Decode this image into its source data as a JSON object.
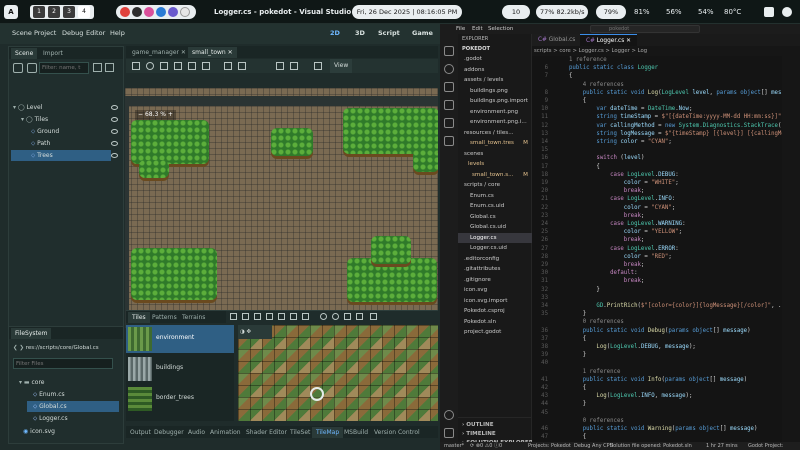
{
  "topbar": {
    "launcher": "A",
    "workspaces": [
      "1",
      "2",
      "3",
      "4"
    ],
    "window_title": "Logger.cs - pokedot - Visual Studio Code",
    "datetime": "Fri, 26 Dec 2025 | 08:16:05 PM",
    "tray": {
      "notif_count": "10",
      "network": "77% 82.2kb/s",
      "battery_pct": "79%",
      "cpu": "81%",
      "mem": "56%",
      "vol": "54%",
      "temp": "80°C"
    }
  },
  "godot": {
    "menu": [
      "Scene",
      "Project",
      "Debug",
      "Editor",
      "Help"
    ],
    "modes": {
      "two_d": "2D",
      "three_d": "3D",
      "script": "Script",
      "game": "Game"
    },
    "scene_tabs": {
      "scene": "Scene",
      "import": "Import"
    },
    "filter_placeholder": "Filter: name, t",
    "scene_tree": [
      {
        "label": "Level"
      },
      {
        "label": "Tiles"
      },
      {
        "label": "Ground"
      },
      {
        "label": "Path"
      },
      {
        "label": "Trees"
      }
    ],
    "editor_tabs": {
      "game_manager": "game_manager",
      "small_town": "small_town"
    },
    "view_btn": "View",
    "zoom": "68.3 %",
    "filesystem": {
      "title": "FileSystem",
      "path": "res://scripts/core/Global.cs",
      "filter_placeholder": "Filter Files",
      "items": [
        {
          "label": "core"
        },
        {
          "label": "Enum.cs"
        },
        {
          "label": "Global.cs"
        },
        {
          "label": "Logger.cs"
        },
        {
          "label": "icon.svg"
        }
      ]
    },
    "tileset_tabs": {
      "tiles": "Tiles",
      "patterns": "Patterns",
      "terrains": "Terrains"
    },
    "sources": [
      {
        "label": "environment"
      },
      {
        "label": "buildings"
      },
      {
        "label": "border_trees"
      }
    ],
    "bottom_tabs": [
      "Output",
      "Debugger",
      "Audio",
      "Animation",
      "Shader Editor",
      "TileSet",
      "TileMap",
      "MSBuild",
      "Version Control"
    ]
  },
  "vscode": {
    "explorer_title": "EXPLORER",
    "project": "POKEDOT",
    "search_placeholder": "pokedot",
    "menu": [
      "File",
      "Edit",
      "Selection"
    ],
    "tabs": {
      "global": "Global.cs",
      "logger": "Logger.cs"
    },
    "breadcrumb": "scripts > core > Logger.cs > Logger > Log",
    "files": [
      {
        "label": ".godot",
        "color": "#cccccc"
      },
      {
        "label": "addons",
        "color": "#cccccc"
      },
      {
        "label": "assets / levels",
        "color": "#cccccc"
      },
      {
        "label": "buildings.png",
        "color": "#cccccc"
      },
      {
        "label": "buildings.png.import",
        "color": "#cccccc"
      },
      {
        "label": "environment.png",
        "color": "#cccccc"
      },
      {
        "label": "environment.png.i...",
        "color": "#cccccc"
      },
      {
        "label": "resources / tiles...",
        "color": "#cccccc"
      },
      {
        "label": "small_town.tres",
        "color": "#e2c08d",
        "badge": "M"
      },
      {
        "label": "scenes",
        "color": "#cccccc"
      },
      {
        "label": "levels",
        "color": "#e2c08d"
      },
      {
        "label": "small_town.s...",
        "color": "#e2c08d",
        "badge": "M"
      },
      {
        "label": "scripts / core",
        "color": "#cccccc"
      },
      {
        "label": "Enum.cs",
        "color": "#cccccc"
      },
      {
        "label": "Enum.cs.uid",
        "color": "#cccccc"
      },
      {
        "label": "Global.cs",
        "color": "#cccccc"
      },
      {
        "label": "Global.cs.uid",
        "color": "#cccccc"
      },
      {
        "label": "Logger.cs",
        "color": "#ffffff"
      },
      {
        "label": "Logger.cs.uid",
        "color": "#cccccc"
      },
      {
        "label": ".editorconfig",
        "color": "#cccccc"
      },
      {
        "label": ".gitattributes",
        "color": "#cccccc"
      },
      {
        "label": ".gitignore",
        "color": "#cccccc"
      },
      {
        "label": "icon.svg",
        "color": "#cccccc"
      },
      {
        "label": "icon.svg.import",
        "color": "#cccccc"
      },
      {
        "label": "Pokedot.csproj",
        "color": "#cccccc"
      },
      {
        "label": "Pokedot.sln",
        "color": "#cccccc"
      },
      {
        "label": "project.godot",
        "color": "#cccccc"
      }
    ],
    "outline": [
      "OUTLINE",
      "TIMELINE",
      "SOLUTION EXPLORER"
    ],
    "code": [
      {
        "ln": "",
        "html": "<span class='ref'>1 reference</span>"
      },
      {
        "ln": "6",
        "html": "<span class='k'>public static class</span> <span class='t'>Logger</span>"
      },
      {
        "ln": "7",
        "html": "<span class='p'>{</span>"
      },
      {
        "ln": "",
        "html": "    <span class='ref'>4 references</span>"
      },
      {
        "ln": "8",
        "html": "    <span class='k'>public static void</span> <span class='f'>Log</span><span class='p'>(</span><span class='t'>LogLevel</span> <span class='v'>level</span><span class='p'>, </span><span class='k'>params object</span><span class='p'>[] </span><span class='v'>message</span><span class='p'>)</span>"
      },
      {
        "ln": "9",
        "html": "    <span class='p'>{</span>"
      },
      {
        "ln": "10",
        "html": "        <span class='k'>var</span> <span class='v'>dateTime</span> <span class='p'>= </span><span class='t'>DateTime</span><span class='p'>.</span><span class='v'>Now</span><span class='p'>;</span>"
      },
      {
        "ln": "11",
        "html": "        <span class='k'>string</span> <span class='v'>timeStamp</span> <span class='p'>= </span><span class='s'>$\"[{dateTime:yyyy-MM-dd HH:mm:ss}]\"</span><span class='p'>;</span>"
      },
      {
        "ln": "12",
        "html": "        <span class='k'>var</span> <span class='v'>callingMethod</span> <span class='p'>= </span><span class='k'>new</span> <span class='t'>System.Diagnostics.StackTrace</span><span class='p'>().</span><span class='f'>GetFra</span>"
      },
      {
        "ln": "13",
        "html": "        <span class='k'>string</span> <span class='v'>logMessage</span> <span class='p'>= </span><span class='s'>$\"{timeStamp} [{level}] [{callingMethod.D</span>"
      },
      {
        "ln": "14",
        "html": "        <span class='k'>string</span> <span class='v'>color</span> <span class='p'>= </span><span class='s'>\"CYAN\"</span><span class='p'>;</span>"
      },
      {
        "ln": "15",
        "html": ""
      },
      {
        "ln": "16",
        "html": "        <span class='c'>switch</span> <span class='p'>(</span><span class='v'>level</span><span class='p'>)</span>"
      },
      {
        "ln": "17",
        "html": "        <span class='p'>{</span>"
      },
      {
        "ln": "18",
        "html": "            <span class='c'>case</span> <span class='t'>LogLevel</span><span class='p'>.</span><span class='v'>DEBUG</span><span class='p'>:</span>"
      },
      {
        "ln": "19",
        "html": "                <span class='v'>color</span> <span class='p'>= </span><span class='s'>\"WHITE\"</span><span class='p'>;</span>"
      },
      {
        "ln": "20",
        "html": "                <span class='c'>break</span><span class='p'>;</span>"
      },
      {
        "ln": "21",
        "html": "            <span class='c'>case</span> <span class='t'>LogLevel</span><span class='p'>.</span><span class='v'>INFO</span><span class='p'>:</span>"
      },
      {
        "ln": "22",
        "html": "                <span class='v'>color</span> <span class='p'>= </span><span class='s'>\"CYAN\"</span><span class='p'>;</span>"
      },
      {
        "ln": "23",
        "html": "                <span class='c'>break</span><span class='p'>;</span>"
      },
      {
        "ln": "24",
        "html": "            <span class='c'>case</span> <span class='t'>LogLevel</span><span class='p'>.</span><span class='v'>WARNING</span><span class='p'>:</span>"
      },
      {
        "ln": "25",
        "html": "                <span class='v'>color</span> <span class='p'>= </span><span class='s'>\"YELLOW\"</span><span class='p'>;</span>"
      },
      {
        "ln": "26",
        "html": "                <span class='c'>break</span><span class='p'>;</span>"
      },
      {
        "ln": "27",
        "html": "            <span class='c'>case</span> <span class='t'>LogLevel</span><span class='p'>.</span><span class='v'>ERROR</span><span class='p'>:</span>"
      },
      {
        "ln": "28",
        "html": "                <span class='v'>color</span> <span class='p'>= </span><span class='s'>\"RED\"</span><span class='p'>;</span>"
      },
      {
        "ln": "29",
        "html": "                <span class='c'>break</span><span class='p'>;</span>"
      },
      {
        "ln": "30",
        "html": "            <span class='c'>default</span><span class='p'>:</span>"
      },
      {
        "ln": "31",
        "html": "                <span class='c'>break</span><span class='p'>;</span>"
      },
      {
        "ln": "32",
        "html": "        <span class='p'>}</span>"
      },
      {
        "ln": "33",
        "html": ""
      },
      {
        "ln": "34",
        "html": "        <span class='t'>GD</span><span class='p'>.</span><span class='f'>PrintRich</span><span class='p'>(</span><span class='s'>$\"[color={color}]{logMessage}[/color]\"</span><span class='p'>, .. mess</span>"
      },
      {
        "ln": "35",
        "html": "    <span class='p'>}</span>"
      },
      {
        "ln": "",
        "html": "    <span class='ref'>0 references</span>"
      },
      {
        "ln": "36",
        "html": "    <span class='k'>public static void</span> <span class='f'>Debug</span><span class='p'>(</span><span class='k'>params object</span><span class='p'>[] </span><span class='v'>message</span><span class='p'>)</span>"
      },
      {
        "ln": "37",
        "html": "    <span class='p'>{</span>"
      },
      {
        "ln": "38",
        "html": "        <span class='f'>Log</span><span class='p'>(</span><span class='t'>LogLevel</span><span class='p'>.</span><span class='v'>DEBUG</span><span class='p'>, </span><span class='v'>message</span><span class='p'>);</span>"
      },
      {
        "ln": "39",
        "html": "    <span class='p'>}</span>"
      },
      {
        "ln": "40",
        "html": ""
      },
      {
        "ln": "",
        "html": "    <span class='ref'>1 reference</span>"
      },
      {
        "ln": "41",
        "html": "    <span class='k'>public static void</span> <span class='f'>Info</span><span class='p'>(</span><span class='k'>params object</span><span class='p'>[] </span><span class='v'>message</span><span class='p'>)</span>"
      },
      {
        "ln": "42",
        "html": "    <span class='p'>{</span>"
      },
      {
        "ln": "43",
        "html": "        <span class='f'>Log</span><span class='p'>(</span><span class='t'>LogLevel</span><span class='p'>.</span><span class='v'>INFO</span><span class='p'>, </span><span class='v'>message</span><span class='p'>);</span>"
      },
      {
        "ln": "44",
        "html": "    <span class='p'>}</span>"
      },
      {
        "ln": "45",
        "html": ""
      },
      {
        "ln": "",
        "html": "    <span class='ref'>0 references</span>"
      },
      {
        "ln": "46",
        "html": "    <span class='k'>public static void</span> <span class='f'>Warning</span><span class='p'>(</span><span class='k'>params object</span><span class='p'>[] </span><span class='v'>message</span><span class='p'>)</span>"
      },
      {
        "ln": "47",
        "html": "    <span class='p'>{</span>"
      },
      {
        "ln": "48",
        "html": "        <span class='f'>Log</span><span class='p'>(</span><span class='t'>LogLevel</span><span class='p'>.</span><span class='v'>WARNING</span><span class='p'>, </span><span class='v'>message</span><span class='p'>);</span>"
      }
    ],
    "status": {
      "branch": "master*",
      "sync": "⟳ ⊗0 ⚠0 ⓘ0",
      "projects": "Projects: Pokedot",
      "config": "Debug Any CPU",
      "solution": "Solution file opened: Pokedot.sln",
      "time": "1 hr 27 mins",
      "godot": "Godot Project:"
    }
  },
  "colors": {
    "godot_bg": "#1f2c2b",
    "vscode_bg": "#141414",
    "accent_blue": "#2f5f84",
    "keyword": "#569cd6",
    "type": "#4ec9b0",
    "string": "#ce9178"
  }
}
